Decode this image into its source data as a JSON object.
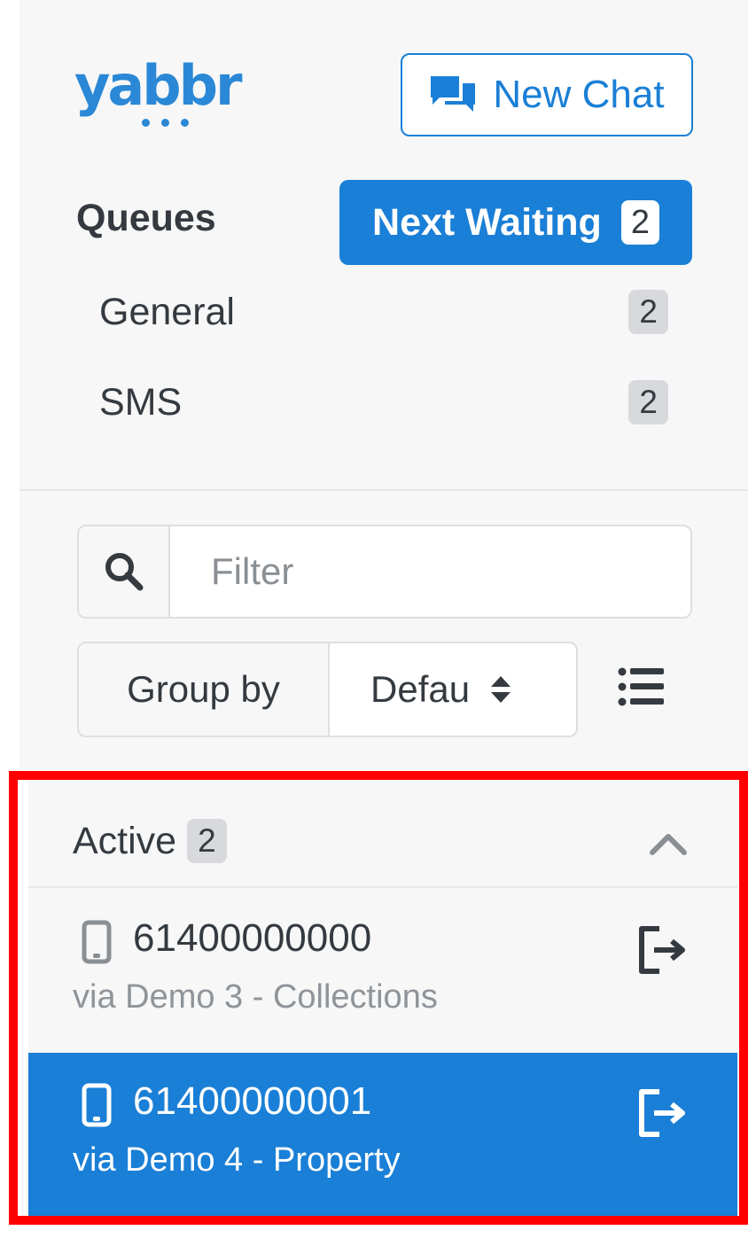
{
  "logo": {
    "text": "yabbr"
  },
  "header": {
    "new_chat_label": "New Chat",
    "new_chat_icon": "chat-bubbles-icon"
  },
  "queues": {
    "title": "Queues",
    "next_waiting_label": "Next Waiting",
    "next_waiting_count": "2",
    "items": [
      {
        "label": "General",
        "count": "2"
      },
      {
        "label": "SMS",
        "count": "2"
      }
    ]
  },
  "filter": {
    "placeholder": "Filter",
    "value": ""
  },
  "group_by": {
    "label": "Group by",
    "selected": "Defau"
  },
  "active": {
    "title": "Active",
    "count": "2",
    "chats": [
      {
        "phone": "61400000000",
        "via": "via Demo 3 - Collections",
        "selected": false
      },
      {
        "phone": "61400000001",
        "via": "via Demo 4 - Property",
        "selected": true
      }
    ]
  },
  "colors": {
    "primary": "#1a7fd6",
    "panel_bg": "#f7f7f7",
    "badge_grey": "#d7d9dc",
    "highlight_border": "#ff0000"
  }
}
